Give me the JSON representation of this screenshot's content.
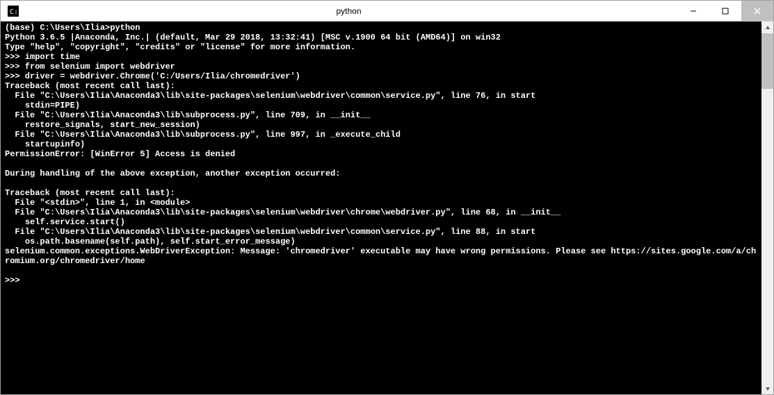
{
  "window": {
    "title": "python"
  },
  "terminal": {
    "lines": [
      "(base) C:\\Users\\Ilia>python",
      "Python 3.6.5 |Anaconda, Inc.| (default, Mar 29 2018, 13:32:41) [MSC v.1900 64 bit (AMD64)] on win32",
      "Type \"help\", \"copyright\", \"credits\" or \"license\" for more information.",
      ">>> import time",
      ">>> from selenium import webdriver",
      ">>> driver = webdriver.Chrome('C:/Users/Ilia/chromedriver')",
      "Traceback (most recent call last):",
      "  File \"C:\\Users\\Ilia\\Anaconda3\\lib\\site-packages\\selenium\\webdriver\\common\\service.py\", line 76, in start",
      "    stdin=PIPE)",
      "  File \"C:\\Users\\Ilia\\Anaconda3\\lib\\subprocess.py\", line 709, in __init__",
      "    restore_signals, start_new_session)",
      "  File \"C:\\Users\\Ilia\\Anaconda3\\lib\\subprocess.py\", line 997, in _execute_child",
      "    startupinfo)",
      "PermissionError: [WinError 5] Access is denied",
      "",
      "During handling of the above exception, another exception occurred:",
      "",
      "Traceback (most recent call last):",
      "  File \"<stdin>\", line 1, in <module>",
      "  File \"C:\\Users\\Ilia\\Anaconda3\\lib\\site-packages\\selenium\\webdriver\\chrome\\webdriver.py\", line 68, in __init__",
      "    self.service.start()",
      "  File \"C:\\Users\\Ilia\\Anaconda3\\lib\\site-packages\\selenium\\webdriver\\common\\service.py\", line 88, in start",
      "    os.path.basename(self.path), self.start_error_message)",
      "selenium.common.exceptions.WebDriverException: Message: 'chromedriver' executable may have wrong permissions. Please see https://sites.google.com/a/chromium.org/chromedriver/home",
      "",
      ">>>"
    ]
  }
}
